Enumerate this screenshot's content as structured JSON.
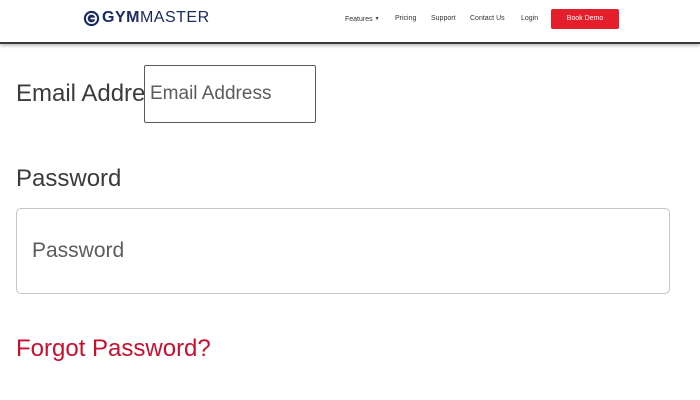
{
  "header": {
    "logo": {
      "part1": "GYM",
      "part2": "MASTER",
      "icon": "gymmaster-logo-icon"
    },
    "nav": {
      "features": "Features",
      "pricing": "Pricing",
      "support": "Support",
      "contact": "Contact Us",
      "login": "Login"
    },
    "book_demo": "Book Demo"
  },
  "form": {
    "email_label": "Email Address",
    "email_placeholder": "Email Address",
    "password_label": "Password",
    "password_placeholder": "Password",
    "forgot_link": "Forgot Password?"
  },
  "colors": {
    "brand": "#1a2a63",
    "accent_red": "#e41f2b",
    "link_red": "#c8102e"
  }
}
